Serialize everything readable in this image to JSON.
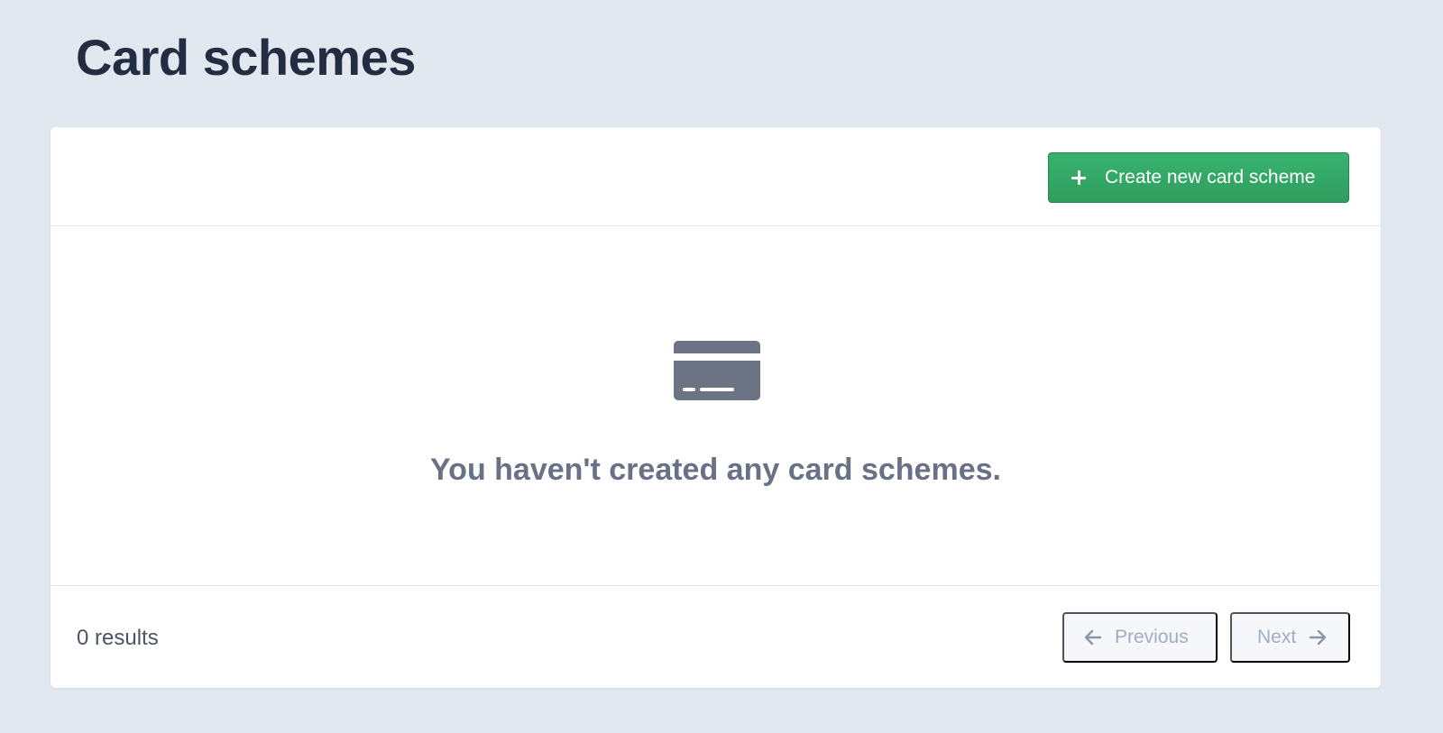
{
  "page": {
    "title": "Card schemes"
  },
  "toolbar": {
    "create_label": "Create new card scheme",
    "create_icon": "plus-icon"
  },
  "empty_state": {
    "icon": "credit-card-icon",
    "message": "You haven't created any card schemes."
  },
  "footer": {
    "results": "0 results",
    "previous_label": "Previous",
    "next_label": "Next"
  },
  "colors": {
    "background": "#e2e8f0",
    "primary_button": "#38b36f",
    "title_text": "#242c42",
    "muted_text": "#687185",
    "disabled_text": "#a0aec0"
  }
}
